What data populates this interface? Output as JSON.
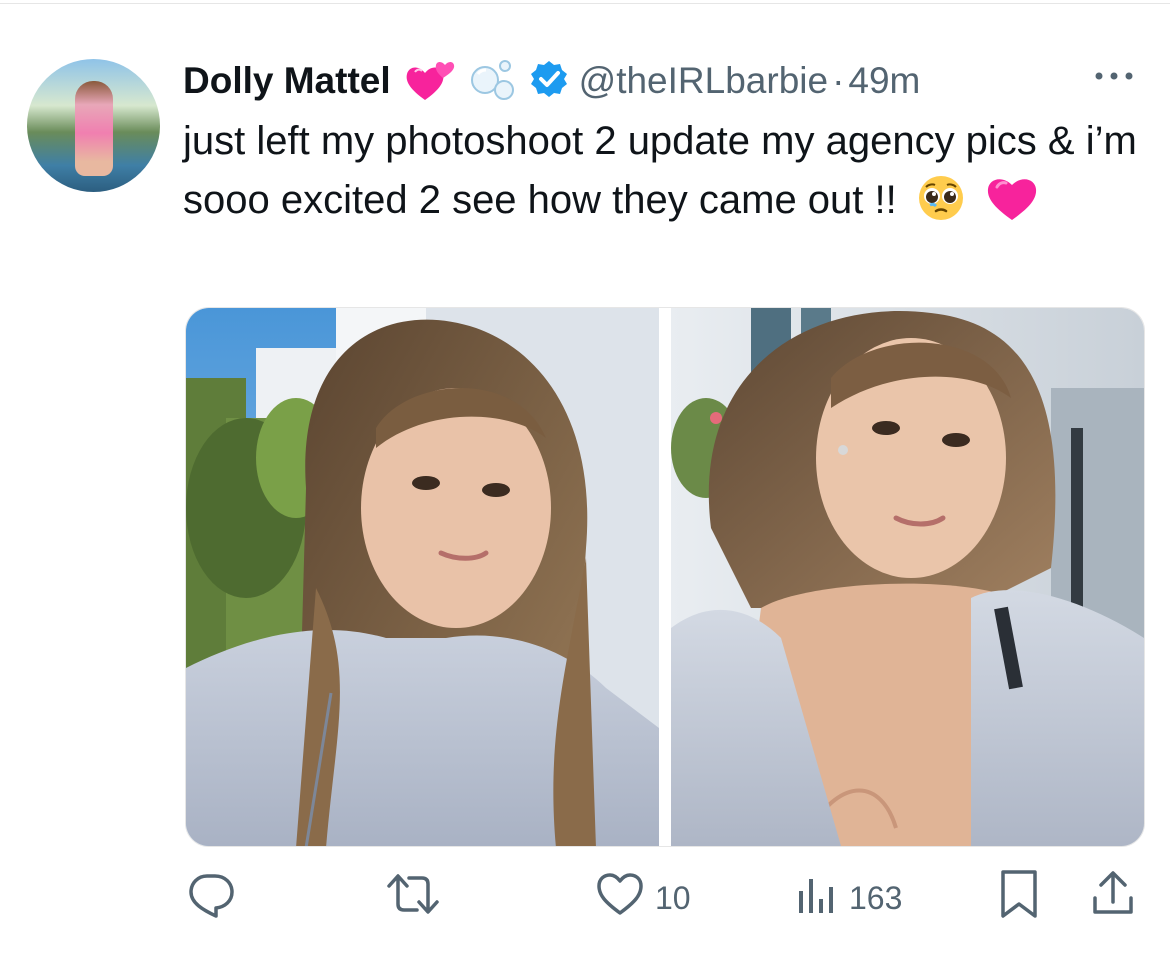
{
  "tweet": {
    "author_name": "Dolly Mattel",
    "handle": "@theIRLbarbie",
    "separator": "·",
    "time": "49m",
    "text": "just left my photoshoot 2 update my agency pics & i’m sooo excited 2 see how they came out !!",
    "name_emojis": [
      "two-hearts-icon",
      "bubbles-icon"
    ],
    "text_emojis": [
      "pleading-face-icon",
      "pink-heart-icon"
    ]
  },
  "media": {
    "photos": [
      {
        "name": "selfie-photo-1"
      },
      {
        "name": "selfie-photo-2"
      }
    ]
  },
  "actions": {
    "reply": {
      "icon": "reply-icon",
      "count": ""
    },
    "retweet": {
      "icon": "retweet-icon",
      "count": ""
    },
    "like": {
      "icon": "heart-icon",
      "count": "10"
    },
    "views": {
      "icon": "views-chart-icon",
      "count": "163"
    },
    "bookmark": {
      "icon": "bookmark-icon"
    },
    "share": {
      "icon": "share-icon"
    }
  },
  "colors": {
    "text": "#0f1419",
    "secondary": "#536471",
    "verified": "#1d9bf0",
    "pink": "#f7239c"
  }
}
